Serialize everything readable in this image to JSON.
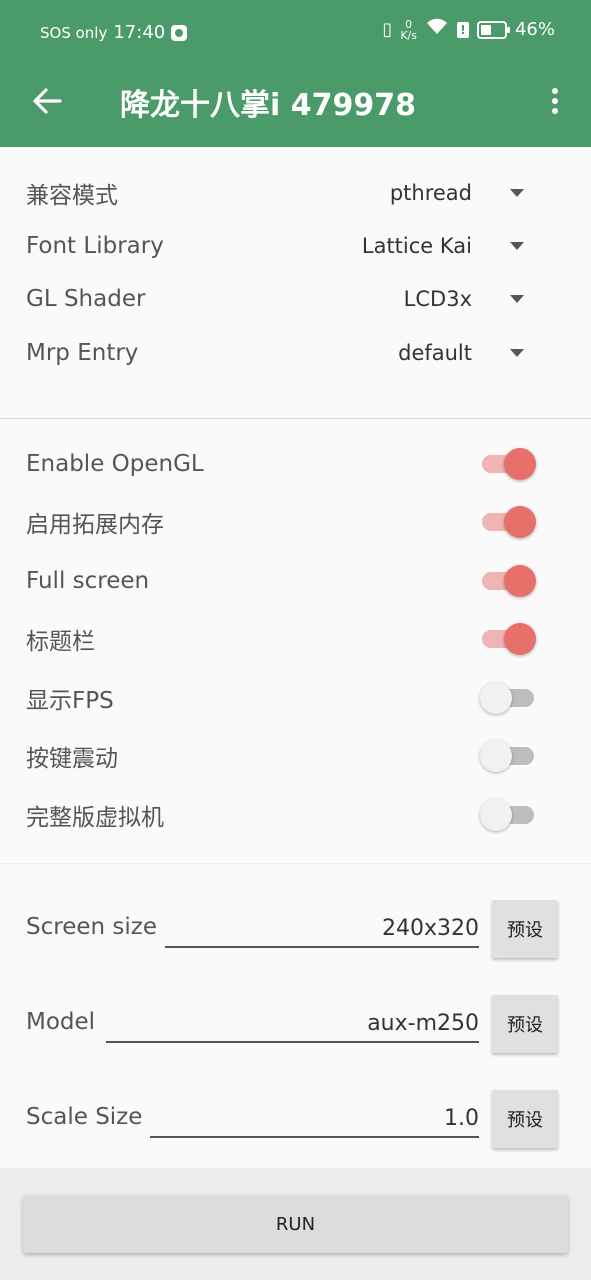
{
  "status_bar": {
    "carrier": "SOS only",
    "time": "17:40",
    "net_speed_value": "0",
    "net_speed_unit": "K/s",
    "battery": "46%",
    "battery_level": 0.46
  },
  "app_bar": {
    "title": "降龙十八掌i 479978"
  },
  "dropdowns": [
    {
      "label": "兼容模式",
      "value": "pthread"
    },
    {
      "label": "Font Library",
      "value": "Lattice Kai"
    },
    {
      "label": "GL Shader",
      "value": "LCD3x"
    },
    {
      "label": "Mrp Entry",
      "value": "default"
    }
  ],
  "switches": [
    {
      "label": "Enable OpenGL",
      "on": true
    },
    {
      "label": "启用拓展内存",
      "on": true
    },
    {
      "label": "Full screen",
      "on": true
    },
    {
      "label": "标题栏",
      "on": true
    },
    {
      "label": "显示FPS",
      "on": false
    },
    {
      "label": "按键震动",
      "on": false
    },
    {
      "label": "完整版虚拟机",
      "on": false
    }
  ],
  "fields": [
    {
      "label": "Screen size",
      "value": "240x320",
      "button": "预设"
    },
    {
      "label": "Model",
      "value": "aux-m250",
      "button": "预设"
    },
    {
      "label": "Scale Size",
      "value": "1.0",
      "button": "预设"
    }
  ],
  "run_label": "RUN",
  "colors": {
    "app_bar": "#4a9a6a",
    "switch_on": "#e8706a",
    "switch_track_on": "#f0b4b4"
  }
}
